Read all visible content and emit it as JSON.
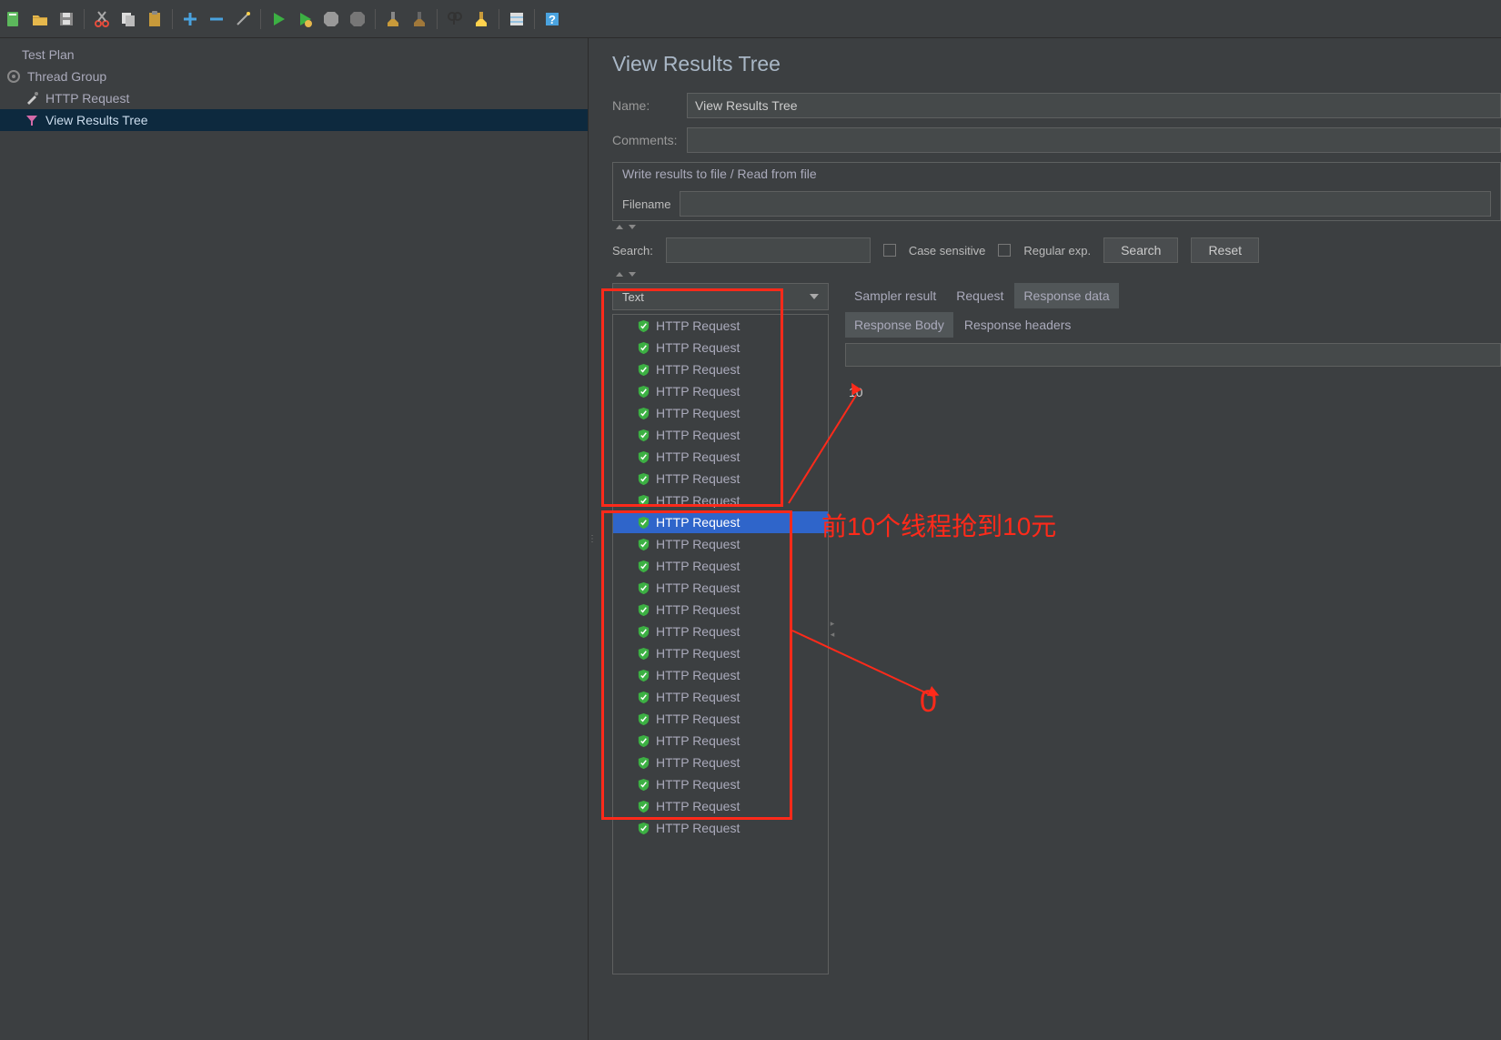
{
  "toolbar": {},
  "tree": {
    "n0": "Test Plan",
    "n1": "Thread Group",
    "n2": "HTTP Request",
    "n3": "View Results Tree"
  },
  "panel": {
    "title": "View Results Tree",
    "name_label": "Name:",
    "name_value": "View Results Tree",
    "comments_label": "Comments:",
    "comments_value": "",
    "file_section": "Write results to file / Read from file",
    "filename_label": "Filename",
    "filename_value": ""
  },
  "search": {
    "label": "Search:",
    "value": "",
    "case_label": "Case sensitive",
    "regex_label": "Regular exp.",
    "search_btn": "Search",
    "reset_btn": "Reset"
  },
  "renderer": {
    "selected": "Text"
  },
  "samples": {
    "label": "HTTP Request",
    "rows": [
      "HTTP Request",
      "HTTP Request",
      "HTTP Request",
      "HTTP Request",
      "HTTP Request",
      "HTTP Request",
      "HTTP Request",
      "HTTP Request",
      "HTTP Request",
      "HTTP Request",
      "HTTP Request",
      "HTTP Request",
      "HTTP Request",
      "HTTP Request",
      "HTTP Request",
      "HTTP Request",
      "HTTP Request",
      "HTTP Request",
      "HTTP Request",
      "HTTP Request",
      "HTTP Request",
      "HTTP Request",
      "HTTP Request",
      "HTTP Request"
    ],
    "selected_index": 9
  },
  "tabs": {
    "t0": "Sampler result",
    "t1": "Request",
    "t2": "Response data",
    "s0": "Response Body",
    "s1": "Response headers"
  },
  "response": {
    "body": "10"
  },
  "annotations": {
    "a1": "前10个线程抢到10元",
    "a2": "0"
  }
}
